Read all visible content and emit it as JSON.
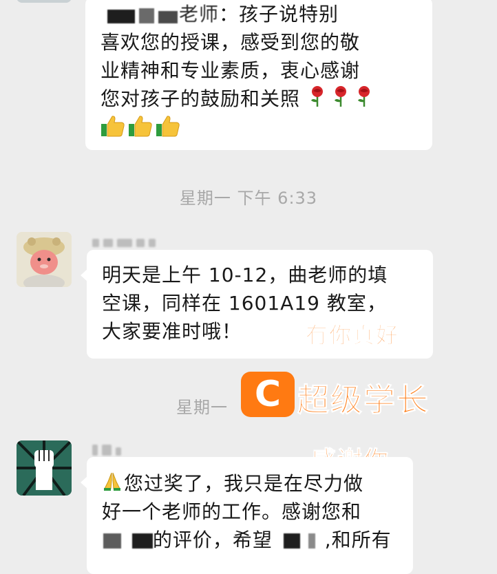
{
  "messages": [
    {
      "lines": [
        "：孩子说特别",
        "喜欢您的授课，感受到您的敬",
        "业精神和专业素质，衷心感谢",
        "您对孩子的鼓励和关照"
      ],
      "title_suffix": "老师",
      "emoji": [
        "rose",
        "rose",
        "rose",
        "thumbs-up",
        "thumbs-up",
        "thumbs-up"
      ]
    },
    {
      "timestamp": "星期一 下午 6:33",
      "lines": [
        "明天是上午 10-12，曲老师的填",
        "空课，同样在 1601A19 教室，",
        "大家要准时哦！"
      ]
    },
    {
      "timestamp_partial": "星期一",
      "lines": [
        "您过奖了，我只是在尽力做",
        "好一个老师的工作。感谢您和",
        "的评价，希望",
        ",和所有"
      ],
      "emoji": [
        "folded-hands"
      ]
    }
  ],
  "watermarks": {
    "caption_1": "有你真好",
    "brand_logo_letter": "C",
    "brand": "超级学长",
    "caption_2": "感谢你"
  },
  "colors": {
    "background": "#ededed",
    "bubble": "#ffffff",
    "text": "#191919",
    "timestamp": "#a8a8a8",
    "watermark": "#ff7a12"
  }
}
